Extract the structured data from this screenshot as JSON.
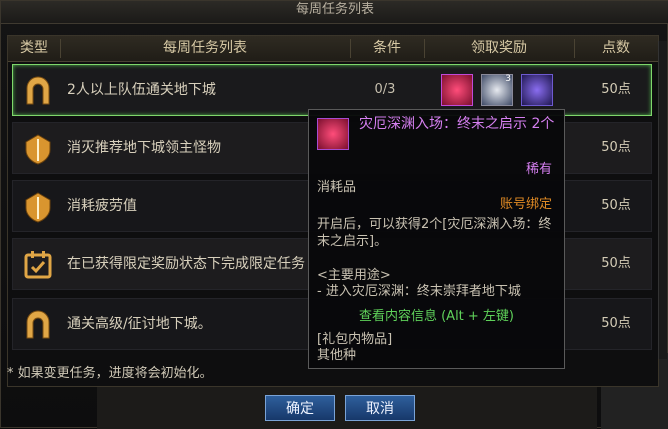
{
  "window": {
    "title": "每周任务列表"
  },
  "table": {
    "headers": [
      "类型",
      "每周任务列表",
      "条件",
      "领取奖励",
      "点数"
    ],
    "rows": [
      {
        "icon": "arch-gate-icon",
        "text": "2人以上队伍通关地下城",
        "condition": "0/3",
        "points": "50点",
        "reward_qty": "3"
      },
      {
        "icon": "shield-emblem-icon",
        "text": "消灭推荐地下城领主怪物",
        "condition": "",
        "points": "50点"
      },
      {
        "icon": "shield-emblem-icon",
        "text": "消耗疲劳值",
        "condition": "",
        "points": "50点"
      },
      {
        "icon": "calendar-check-icon",
        "text": "在已获得限定奖励状态下完成限定任务",
        "condition": "",
        "points": "50点"
      },
      {
        "icon": "arch-gate-icon",
        "text": "通关高级/征讨地下城。",
        "condition": "",
        "points": "50点"
      }
    ]
  },
  "note": "* 如果变更任务，进度将会初始化。",
  "buttons": {
    "confirm": "确定",
    "cancel": "取消"
  },
  "tooltip": {
    "name": "灾厄深渊入场：终末之启示 2个",
    "rarity": "稀有",
    "type": "消耗品",
    "bind": "账号绑定",
    "description": "开启后，可以获得2个[灾厄深渊入场：终末之启示]。",
    "usage_header": "<主要用途>",
    "usage": "- 进入灾厄深渊：终末崇拜者地下城",
    "hint": "查看内容信息 (Alt + 左键)",
    "pack_header": "[礼包内物品]",
    "pack_item": "其他种"
  },
  "colors": {
    "accent_green": "#7fd66b",
    "rare_purple": "#d57ff0",
    "bind_orange": "#e08a24",
    "button_blue": "#2e5f9c"
  }
}
